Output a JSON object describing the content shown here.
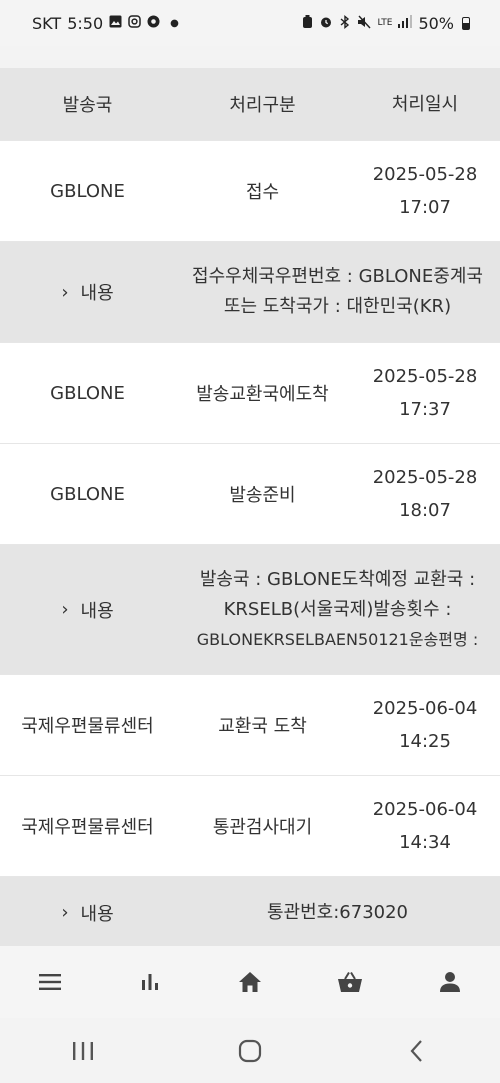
{
  "status_bar": {
    "carrier": "SKT",
    "time": "5:50",
    "network": "LTE",
    "battery": "50%"
  },
  "table": {
    "headers": [
      "발송국",
      "처리구분",
      "처리일시"
    ],
    "rows": [
      {
        "sender": "GBLONE",
        "status": "접수",
        "date": "2025-05-28",
        "time": "17:07"
      },
      {
        "detail_label": "내용",
        "detail_lines": [
          "접수우체국우편번호 : GBLONE중계국",
          "또는 도착국가 : 대한민국(KR)"
        ]
      },
      {
        "sender": "GBLONE",
        "status": "발송교환국에도착",
        "date": "2025-05-28",
        "time": "17:37"
      },
      {
        "sender": "GBLONE",
        "status": "발송준비",
        "date": "2025-05-28",
        "time": "18:07"
      },
      {
        "detail_label": "내용",
        "detail_lines": [
          "발송국 : GBLONE도착예정 교환국 :",
          "KRSELB(서울국제)발송횟수 :",
          "GBLONEKRSELBAEN50121운송편명 :"
        ]
      },
      {
        "sender": "국제우편물류센터",
        "status": "교환국 도착",
        "date": "2025-06-04",
        "time": "14:25"
      },
      {
        "sender": "국제우편물류센터",
        "status": "통관검사대기",
        "date": "2025-06-04",
        "time": "14:34"
      },
      {
        "detail_label": "내용",
        "detail_lines": [
          "통관번호:673020"
        ]
      }
    ]
  },
  "bottom_nav": {
    "items": [
      "menu-icon",
      "chart-icon",
      "home-icon",
      "basket-icon",
      "user-icon"
    ]
  },
  "system_nav": {
    "items": [
      "recents-icon",
      "home-circle-icon",
      "back-icon"
    ]
  },
  "colors": {
    "header_bg": "#e5e5e5",
    "detail_bg": "#e5e5e5",
    "row_bg": "#ffffff",
    "icon_color": "#444444"
  }
}
